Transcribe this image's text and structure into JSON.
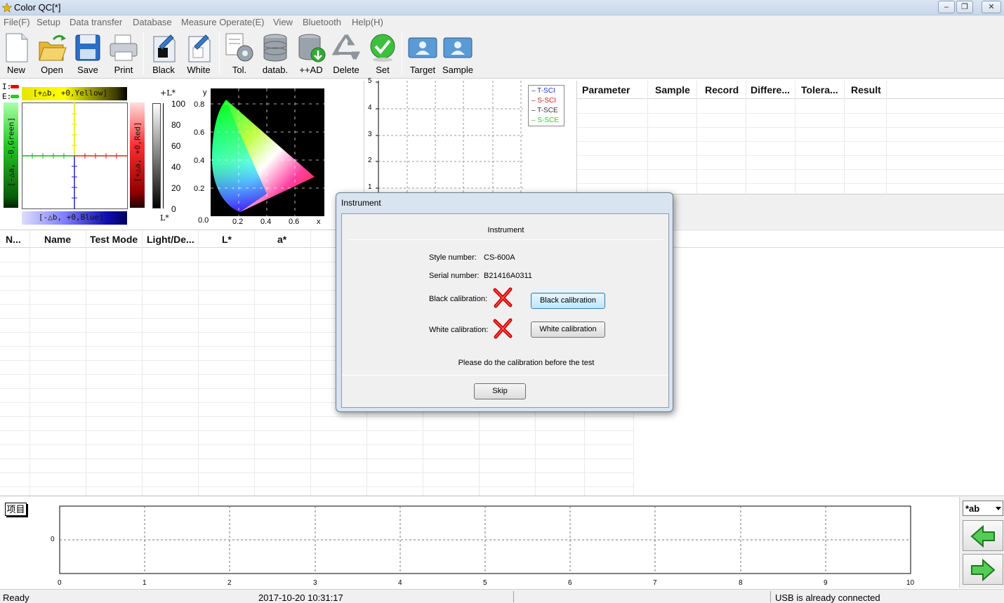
{
  "window": {
    "title": "Color QC[*]"
  },
  "menu": [
    "File(F)",
    "Setup",
    "Data transfer",
    "Database",
    "Measure Operate(E)",
    "View",
    "Bluetooth",
    "Help(H)"
  ],
  "toolbar": {
    "buttons": [
      {
        "label": "New",
        "icon": "new-file-icon"
      },
      {
        "label": "Open",
        "icon": "folder-open-icon"
      },
      {
        "label": "Save",
        "icon": "floppy-disk-icon"
      },
      {
        "label": "Print",
        "icon": "printer-icon"
      },
      {
        "label": "Black",
        "icon": "black-calibration-icon"
      },
      {
        "label": "White",
        "icon": "white-calibration-icon"
      },
      {
        "label": "Tol.",
        "icon": "tolerance-gear-icon"
      },
      {
        "label": "datab.",
        "icon": "database-icon"
      },
      {
        "label": "++AD",
        "icon": "database-add-icon"
      },
      {
        "label": "Delete",
        "icon": "recycle-icon"
      },
      {
        "label": "Set",
        "icon": "checkmark-icon"
      },
      {
        "label": "Target",
        "icon": "target-person-icon"
      },
      {
        "label": "Sample",
        "icon": "sample-person-icon"
      }
    ]
  },
  "color_panel": {
    "legend_i": "I:",
    "legend_e": "E:",
    "yellow_label": "[+△b, +0,Yellow]",
    "blue_label": "[-△b, +0,Blue]",
    "green_label": "[-△a, -0,Green]",
    "red_label": "[+△a, +0,Red]",
    "l_top": "+L*",
    "l_bottom": "L*",
    "l_ticks": [
      "100",
      "80",
      "60",
      "40",
      "20",
      "0"
    ],
    "cie_y_axis": "y",
    "cie_x_axis": "x",
    "cie_y_ticks": [
      "0.8",
      "0.6",
      "0.4",
      "0.2"
    ],
    "cie_x_ticks": [
      "0.0",
      "0.2",
      "0.4",
      "0.6"
    ]
  },
  "spectrum_chart": {
    "y_ticks": [
      "5",
      "4",
      "3",
      "2",
      "1"
    ],
    "legend": [
      "T-SCI",
      "S-SCI",
      "T-SCE",
      "S-SCE"
    ],
    "legend_colors": [
      "#2233cc",
      "#cc2222",
      "#333333",
      "#33cc33"
    ]
  },
  "param_table": {
    "headers": [
      "Parameter",
      "Sample",
      "Record",
      "Differe...",
      "Tolera...",
      "Result"
    ]
  },
  "data_table": {
    "headers": [
      "N...",
      "Name",
      "Test Mode",
      "Light/De...",
      "L*",
      "a*"
    ]
  },
  "bottom_chart": {
    "tag": "项目",
    "y_tick": "0",
    "x_ticks": [
      "0",
      "1",
      "2",
      "3",
      "4",
      "5",
      "6",
      "7",
      "8",
      "9",
      "10"
    ],
    "select_value": "*ab"
  },
  "status": {
    "left": "Ready",
    "datetime": "2017-10-20 10:31:17",
    "right": "USB is already connected"
  },
  "dialog": {
    "title": "Instrument",
    "heading": "Instrument",
    "style_label": "Style number:",
    "style_value": "CS-600A",
    "serial_label": "Serial number:",
    "serial_value": "B21416A0311",
    "black_label": "Black calibration:",
    "black_button": "Black calibration",
    "white_label": "White calibration:",
    "white_button": "White calibration",
    "message": "Please do the calibration before the test",
    "skip_button": "Skip"
  }
}
